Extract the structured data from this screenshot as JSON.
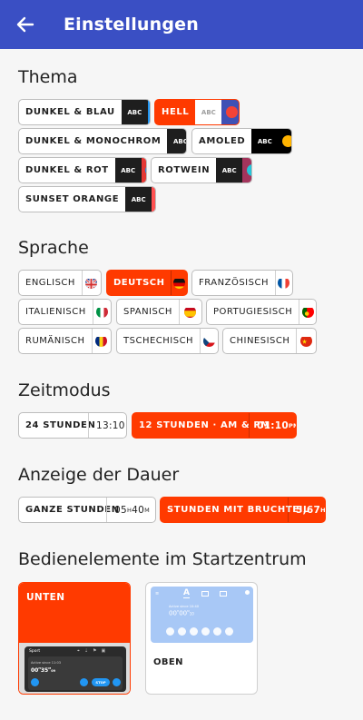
{
  "header": {
    "title": "Einstellungen",
    "back_icon": "arrow-left-icon"
  },
  "sections": {
    "theme": "Thema",
    "language": "Sprache",
    "timemode": "Zeitmodus",
    "duration": "Anzeige der Dauer",
    "controls": "Bedienelemente im Startzentrum"
  },
  "themes": [
    {
      "label": "DUNKEL & BLAU",
      "abc": "ABC",
      "abc_bg": "#1e1e1e",
      "abc_fg": "#ffffff",
      "acc_bg": "#2196f3",
      "dot": "#ff9800",
      "selected": false
    },
    {
      "label": "HELL",
      "abc": "ABC",
      "abc_bg": "#ffffff",
      "abc_fg": "#9e9e9e",
      "acc_bg": "#3f51b5",
      "dot": "#f44336",
      "selected": true
    },
    {
      "label": "DUNKEL & MONOCHROM",
      "abc": "ABC",
      "abc_bg": "#1e1e1e",
      "abc_fg": "#ffffff",
      "acc_bg": "#616161",
      "dot": "#ff5722",
      "selected": false
    },
    {
      "label": "AMOLED",
      "abc": "ABC",
      "abc_bg": "#000000",
      "abc_fg": "#ffffff",
      "acc_bg": "#000000",
      "dot": "#ffb300",
      "selected": false
    },
    {
      "label": "DUNKEL & ROT",
      "abc": "ABC",
      "abc_bg": "#1e1e1e",
      "abc_fg": "#ffffff",
      "acc_bg": "#e53935",
      "dot": "#2196f3",
      "selected": false
    },
    {
      "label": "ROTWEIN",
      "abc": "ABC",
      "abc_bg": "#1e1e1e",
      "abc_fg": "#ffffff",
      "acc_bg": "#a4345c",
      "dot": "#26c6da",
      "selected": false
    },
    {
      "label": "SUNSET ORANGE",
      "abc": "ABC",
      "abc_bg": "#1e1e1e",
      "abc_fg": "#ffffff",
      "acc_bg": "#ff5252",
      "dot": "#90a4f5",
      "selected": false
    }
  ],
  "languages": [
    {
      "label": "ENGLISCH",
      "flag": "flag-uk-icon",
      "selected": false
    },
    {
      "label": "DEUTSCH",
      "flag": "flag-de-icon",
      "selected": true
    },
    {
      "label": "FRANZÖSISCH",
      "flag": "flag-fr-icon",
      "selected": false
    },
    {
      "label": "ITALIENISCH",
      "flag": "flag-it-icon",
      "selected": false
    },
    {
      "label": "SPANISCH",
      "flag": "flag-es-icon",
      "selected": false
    },
    {
      "label": "PORTUGIESISCH",
      "flag": "flag-pt-icon",
      "selected": false
    },
    {
      "label": "RUMÄNISCH",
      "flag": "flag-ro-icon",
      "selected": false
    },
    {
      "label": "TSCHECHISCH",
      "flag": "flag-cz-icon",
      "selected": false
    },
    {
      "label": "CHINESISCH",
      "flag": "flag-cn-icon",
      "selected": false
    }
  ],
  "timemode": [
    {
      "label": "24 STUNDEN",
      "value": "13:10",
      "selected": false
    },
    {
      "label": "12 STUNDEN · AM & PM",
      "value": "01:10",
      "value_sup": "PM",
      "selected": true
    }
  ],
  "duration": [
    {
      "label": "GANZE STUNDEN",
      "value_h": "05",
      "unit_h": "H",
      "value_m": "40",
      "unit_m": "M",
      "selected": false
    },
    {
      "label": "STUNDEN MIT BRUCHTEIL",
      "value": "5,67",
      "value_sup": "H",
      "selected": true
    }
  ],
  "controls": {
    "bottom": {
      "label": "UNTEN",
      "selected": true,
      "preview": {
        "app": "Sport",
        "active": "Active since 11:03",
        "duration": "00",
        "duration_sup1": "H",
        "duration_mid": "35",
        "duration_sup2": "M",
        "duration_tail": "09",
        "stop": "STOP"
      }
    },
    "top": {
      "label": "OBEN",
      "selected": false,
      "preview": {
        "active": "Active since 10:40",
        "duration": "00",
        "duration_sup1": "H",
        "duration_mid": "00",
        "duration_sup2": "M",
        "duration_tail": "10"
      }
    }
  },
  "colors": {
    "primary": "#3a4fc4",
    "accent": "#ff3a00"
  }
}
